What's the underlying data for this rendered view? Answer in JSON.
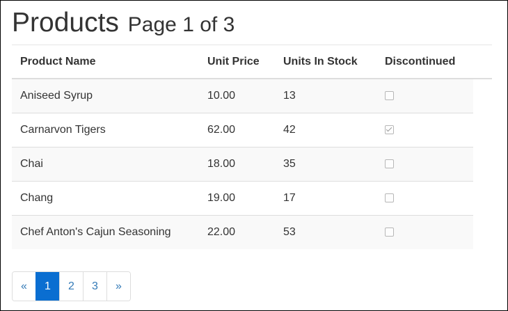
{
  "header": {
    "title": "Products",
    "page_info": "Page 1 of 3"
  },
  "table": {
    "columns": [
      "Product Name",
      "Unit Price",
      "Units In Stock",
      "Discontinued"
    ],
    "rows": [
      {
        "name": "Aniseed Syrup",
        "price": "10.00",
        "stock": "13",
        "discontinued": false
      },
      {
        "name": "Carnarvon Tigers",
        "price": "62.00",
        "stock": "42",
        "discontinued": true
      },
      {
        "name": "Chai",
        "price": "18.00",
        "stock": "35",
        "discontinued": false
      },
      {
        "name": "Chang",
        "price": "19.00",
        "stock": "17",
        "discontinued": false
      },
      {
        "name": "Chef Anton's Cajun Seasoning",
        "price": "22.00",
        "stock": "53",
        "discontinued": false
      }
    ]
  },
  "pager": {
    "prev_label": "«",
    "next_label": "»",
    "pages": [
      "1",
      "2",
      "3"
    ],
    "current_page": "1"
  },
  "colors": {
    "accent": "#0a6ed1",
    "link": "#337ab7",
    "row_stripe": "#f9f9f9"
  }
}
